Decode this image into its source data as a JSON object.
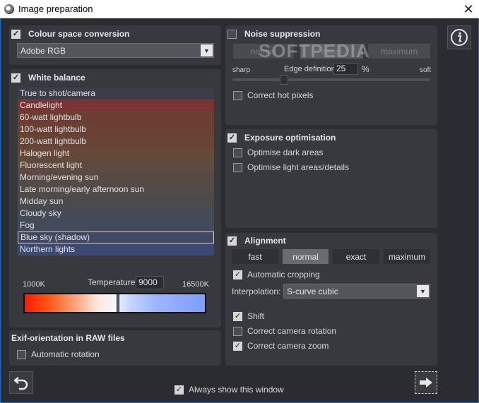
{
  "window": {
    "title": "Image preparation",
    "close_glyph": "✕"
  },
  "colour_space": {
    "label": "Colour space conversion",
    "checked": true,
    "value": "Adobe RGB"
  },
  "white_balance": {
    "label": "White balance",
    "checked": true,
    "items": [
      {
        "label": "True to shot/camera",
        "color": "#3b3d48"
      },
      {
        "label": "Candlelight",
        "color": "#7a3233"
      },
      {
        "label": "60-watt lightbulb",
        "color": "#6c3d32"
      },
      {
        "label": "100-watt lightbulb",
        "color": "#6a4034"
      },
      {
        "label": "200-watt lightbulb",
        "color": "#684436"
      },
      {
        "label": "Halogen light",
        "color": "#654838"
      },
      {
        "label": "Fluorescent light",
        "color": "#5e4a3e"
      },
      {
        "label": "Morning/evening sun",
        "color": "#574a44"
      },
      {
        "label": "Late morning/early afternoon sun",
        "color": "#534b48"
      },
      {
        "label": "Midday sun",
        "color": "#4d4a4c"
      },
      {
        "label": "Cloudy sky",
        "color": "#464a56"
      },
      {
        "label": "Fog",
        "color": "#434a5c"
      },
      {
        "label": "Blue sky (shadow)",
        "color": "#414a62",
        "selected": true
      },
      {
        "label": "Northern lights",
        "color": "#3c4a73"
      }
    ],
    "temp_min": "1000K",
    "temp_max": "16500K",
    "temp_label": "Temperature",
    "temp_value": "9000",
    "temp_fraction": 0.516
  },
  "exif": {
    "label": "Exif-orientation in RAW files",
    "auto_rotation": {
      "label": "Automatic rotation",
      "checked": false
    }
  },
  "noise": {
    "label": "Noise suppression",
    "checked": false,
    "modes": [
      "normal",
      "exact",
      "maximum"
    ],
    "sharp": "sharp",
    "soft": "soft",
    "edge_label": "Edge definition",
    "edge_value": "25",
    "edge_unit": "%",
    "edge_fraction": 0.25,
    "hot_pixels": {
      "label": "Correct hot pixels",
      "checked": false
    }
  },
  "exposure": {
    "label": "Exposure optimisation",
    "checked": true,
    "dark": {
      "label": "Optimise dark areas",
      "checked": false
    },
    "light": {
      "label": "Optimise light areas/details",
      "checked": false
    }
  },
  "alignment": {
    "label": "Alignment",
    "checked": true,
    "modes": [
      "fast",
      "normal",
      "exact",
      "maximum"
    ],
    "active_mode": "normal",
    "auto_crop": {
      "label": "Automatic cropping",
      "checked": true
    },
    "interp_label": "Interpolation:",
    "interp_value": "S-curve cubic",
    "shift": {
      "label": "Shift",
      "checked": true
    },
    "rotation": {
      "label": "Correct camera rotation",
      "checked": false
    },
    "zoom": {
      "label": "Correct camera zoom",
      "checked": true
    }
  },
  "footer": {
    "always_show": {
      "label": "Always show this window",
      "checked": true
    }
  },
  "watermark": "SOFTPEDIA",
  "check_glyph": "✓"
}
